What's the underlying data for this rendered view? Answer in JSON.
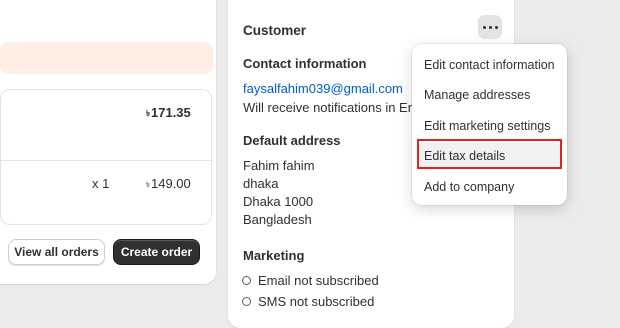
{
  "orders": {
    "amount_1": {
      "currency": "৳",
      "value": "171.35"
    },
    "quantity": "x 1",
    "amount_2": {
      "currency": "৳",
      "value": "149.00"
    },
    "view_all_label": "View all orders",
    "create_label": "Create order"
  },
  "customer": {
    "title": "Customer",
    "contact_heading": "Contact information",
    "email": "faysalfahim039@gmail.com",
    "notify_text": "Will receive notifications in Eng",
    "address_heading": "Default address",
    "address_lines": [
      "Fahim fahim",
      "dhaka",
      "Dhaka 1000",
      "Bangladesh"
    ],
    "marketing_heading": "Marketing",
    "marketing_items": [
      "Email not subscribed",
      "SMS not subscribed"
    ]
  },
  "menu": {
    "items": [
      "Edit contact information",
      "Manage addresses",
      "Edit marketing settings",
      "Edit tax details",
      "Add to company"
    ],
    "highlighted_index": 3
  },
  "colors": {
    "link": "#005bd3",
    "highlight": "#e0241b",
    "warning_banner": "#ffeee4",
    "primary_button": "#303030"
  },
  "icons": {
    "more_actions": "horizontal-ellipsis-icon",
    "marketing_status": "empty-circle-icon"
  }
}
